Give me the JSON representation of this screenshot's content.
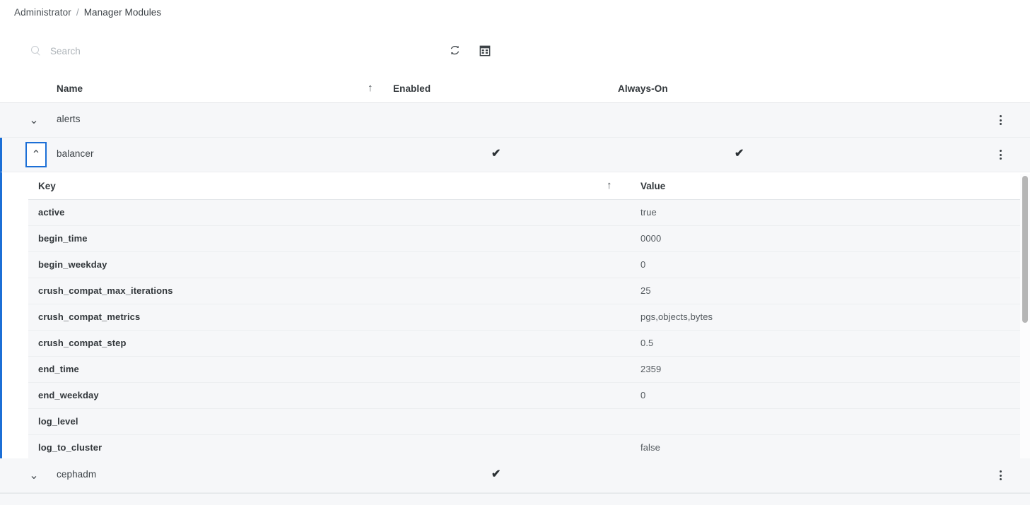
{
  "breadcrumb": {
    "parent": "Administrator",
    "separator": "/",
    "current": "Manager Modules"
  },
  "toolbar": {
    "search_value": "",
    "search_placeholder": "Search",
    "refresh_label": "refresh-icon",
    "columns_label": "table-columns-icon"
  },
  "table": {
    "columns": {
      "name": "Name",
      "enabled": "Enabled",
      "always_on": "Always-On",
      "sort_arrow": "↑"
    },
    "rows": [
      {
        "name": "alerts",
        "chevron": "⌄",
        "enabled": "",
        "always_on": "",
        "expanded": false,
        "selected": false
      },
      {
        "name": "balancer",
        "chevron": "⌃",
        "enabled": "✔",
        "always_on": "✔",
        "expanded": true,
        "selected": true
      },
      {
        "name": "cephadm",
        "chevron": "⌄",
        "enabled": "✔",
        "always_on": "",
        "expanded": false,
        "selected": false
      }
    ]
  },
  "detail_table": {
    "columns": {
      "key": "Key",
      "value": "Value",
      "sort_arrow": "↑"
    },
    "rows": [
      {
        "key": "active",
        "value": "true"
      },
      {
        "key": "begin_time",
        "value": "0000"
      },
      {
        "key": "begin_weekday",
        "value": "0"
      },
      {
        "key": "crush_compat_max_iterations",
        "value": "25"
      },
      {
        "key": "crush_compat_metrics",
        "value": "pgs,objects,bytes"
      },
      {
        "key": "crush_compat_step",
        "value": "0.5"
      },
      {
        "key": "end_time",
        "value": "2359"
      },
      {
        "key": "end_weekday",
        "value": "0"
      },
      {
        "key": "log_level",
        "value": ""
      },
      {
        "key": "log_to_cluster",
        "value": "false"
      }
    ]
  },
  "colors": {
    "accent_blue": "#1c6fd6",
    "row_background": "#f6f7f9",
    "text_primary": "#32373b",
    "text_secondary": "#53595e"
  }
}
